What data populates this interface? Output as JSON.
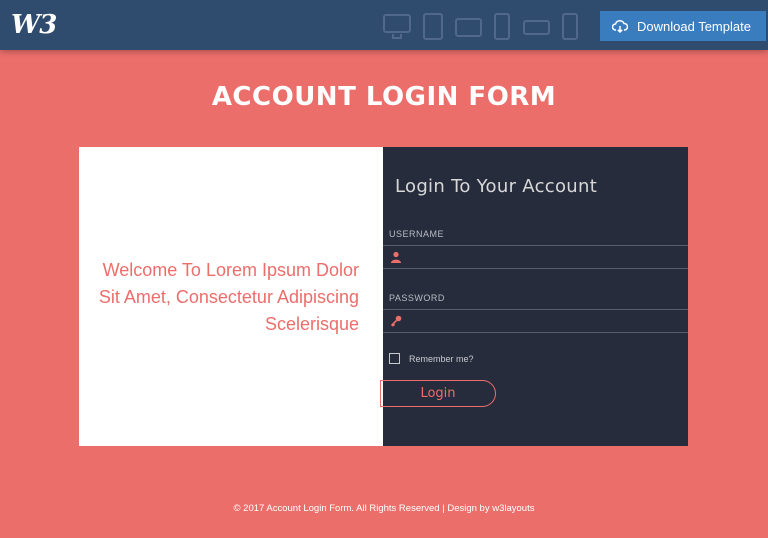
{
  "topbar": {
    "logo_text": "W3",
    "device_icons": [
      "desktop-icon",
      "tablet-icon",
      "tablet-landscape-icon",
      "phone-icon",
      "phone-landscape-icon",
      "basic-phone-icon"
    ],
    "download_label": "Download Template",
    "bg_color": "#2f4b6e",
    "button_color": "#3a7dbf"
  },
  "page": {
    "title": "ACCOUNT LOGIN FORM",
    "bg_color": "#ec6e6b"
  },
  "welcome": {
    "text": "Welcome To Lorem Ipsum Dolor Sit Amet, Consectetur Adipiscing Scelerisque"
  },
  "form": {
    "heading": "Login To Your Account",
    "username_label": "USERNAME",
    "username_value": "",
    "password_label": "PASSWORD",
    "password_value": "",
    "remember_label": "Remember me?",
    "remember_checked": false,
    "login_label": "Login",
    "panel_color": "#272c3c"
  },
  "footer": {
    "text": "© 2017 Account Login Form. All Rights Reserved | Design by w3layouts"
  }
}
